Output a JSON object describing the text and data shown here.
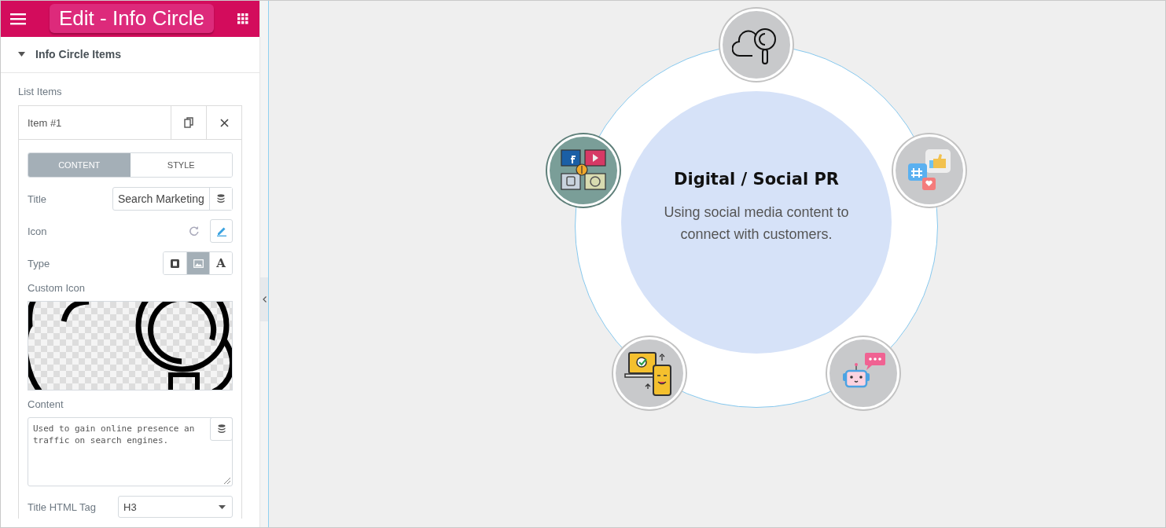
{
  "header": {
    "title": "Edit - Info Circle"
  },
  "section": {
    "title": "Info Circle Items",
    "expanded": true
  },
  "list_label": "List Items",
  "item": {
    "title": "Item #1",
    "tabs": [
      {
        "label": "CONTENT",
        "selected": true
      },
      {
        "label": "STYLE",
        "selected": false
      }
    ],
    "title_label": "Title",
    "title_value": "Search Marketing",
    "icon_label": "Icon",
    "type_label": "Type",
    "type_options": [
      {
        "kind": "slides",
        "selected": false
      },
      {
        "kind": "image",
        "selected": true
      },
      {
        "kind": "text",
        "label": "A",
        "selected": false
      }
    ],
    "custom_icon_label": "Custom Icon",
    "content_label": "Content",
    "content_value": "Used to gain online presence an\ntraffic on search engines.",
    "tag_label": "Title HTML Tag",
    "tag_value": "H3"
  },
  "diagram": {
    "title": "Digital / Social PR",
    "text": "Using social media content to connect with customers.",
    "nodes": [
      {
        "kind": "cloud-search",
        "selected": false
      },
      {
        "kind": "social-likes",
        "selected": false
      },
      {
        "kind": "robot-chat",
        "selected": false
      },
      {
        "kind": "devices",
        "selected": false
      },
      {
        "kind": "social-grid",
        "selected": true
      }
    ]
  }
}
